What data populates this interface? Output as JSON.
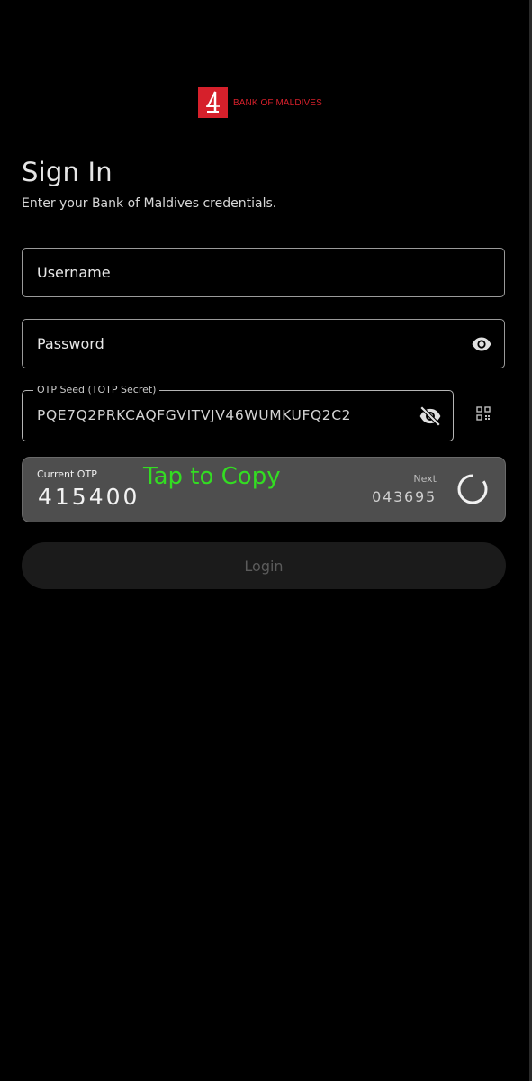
{
  "brand": {
    "name": "BANK OF MALDIVES",
    "color": "#d6202b"
  },
  "header": {
    "title": "Sign In",
    "subtitle": "Enter your Bank of Maldives credentials."
  },
  "form": {
    "username": {
      "placeholder": "Username",
      "value": ""
    },
    "password": {
      "placeholder": "Password",
      "value": "",
      "icon": "eye-icon"
    },
    "otp_seed": {
      "label": "OTP Seed (TOTP Secret)",
      "value": "PQE7Q2PRKCAQFGVITVJV46WUMKUFQ2C2",
      "icon": "eye-off-icon"
    },
    "qr_icon": "qr-code-icon"
  },
  "otp": {
    "current_label": "Current OTP",
    "current_code": "415400",
    "tap_hint": "Tap to Copy",
    "next_label": "Next",
    "next_code": "043695",
    "timer_fraction_remaining": 0.85
  },
  "actions": {
    "login_label": "Login"
  },
  "colors": {
    "accent_green": "#33dd22",
    "panel": "#4e4e4e",
    "background": "#000000"
  }
}
